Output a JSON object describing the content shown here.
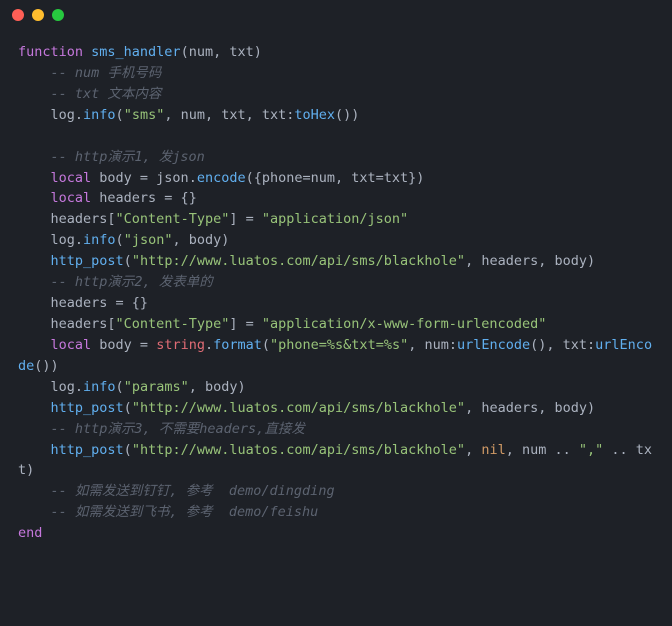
{
  "titlebar": {
    "close": "close",
    "minimize": "minimize",
    "maximize": "maximize"
  },
  "code": {
    "l1_kw": "function",
    "l1_fn": " sms_handler",
    "l1_rest": "(num, txt)",
    "l2": "    -- num 手机号码",
    "l3": "    -- txt 文本内容",
    "l4_a": "    log.",
    "l4_b": "info",
    "l4_c": "(",
    "l4_d": "\"sms\"",
    "l4_e": ", num, txt, txt:",
    "l4_f": "toHex",
    "l4_g": "())",
    "l5": "",
    "l6": "    -- http演示1, 发json",
    "l7_a": "    ",
    "l7_kw": "local",
    "l7_b": " body = json.",
    "l7_c": "encode",
    "l7_d": "({phone=num, txt=txt})",
    "l8_a": "    ",
    "l8_kw": "local",
    "l8_b": " headers = {}",
    "l9_a": "    headers[",
    "l9_b": "\"Content-Type\"",
    "l9_c": "] = ",
    "l9_d": "\"application/json\"",
    "l10_a": "    log.",
    "l10_b": "info",
    "l10_c": "(",
    "l10_d": "\"json\"",
    "l10_e": ", body)",
    "l11_a": "    ",
    "l11_b": "http_post",
    "l11_c": "(",
    "l11_d": "\"http://www.luatos.com/api/sms/blackhole\"",
    "l11_e": ", headers, body)",
    "l12": "    -- http演示2, 发表单的",
    "l13": "    headers = {}",
    "l14_a": "    headers[",
    "l14_b": "\"Content-Type\"",
    "l14_c": "] = ",
    "l14_d": "\"application/x-www-form-urlencoded\"",
    "l15_a": "    ",
    "l15_kw": "local",
    "l15_b": " body = ",
    "l15_c": "string",
    "l15_d": ".",
    "l15_e": "format",
    "l15_f": "(",
    "l15_g": "\"phone=%s&txt=%s\"",
    "l15_h": ", num:",
    "l15_i": "urlEncode",
    "l15_j": "(), txt:",
    "l15_k": "urlEncode",
    "l15_l": "())",
    "l16_a": "    log.",
    "l16_b": "info",
    "l16_c": "(",
    "l16_d": "\"params\"",
    "l16_e": ", body)",
    "l17_a": "    ",
    "l17_b": "http_post",
    "l17_c": "(",
    "l17_d": "\"http://www.luatos.com/api/sms/blackhole\"",
    "l17_e": ", headers, body)",
    "l18": "    -- http演示3, 不需要headers,直接发",
    "l19_a": "    ",
    "l19_b": "http_post",
    "l19_c": "(",
    "l19_d": "\"http://www.luatos.com/api/sms/blackhole\"",
    "l19_e": ", ",
    "l19_f": "nil",
    "l19_g": ", num .. ",
    "l19_h": "\",\"",
    "l19_i": " .. txt)",
    "l20": "    -- 如需发送到钉钉, 参考  demo/dingding",
    "l21": "    -- 如需发送到飞书, 参考  demo/feishu",
    "l22": "end"
  }
}
